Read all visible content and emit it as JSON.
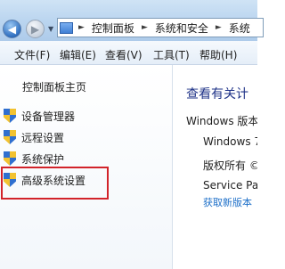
{
  "nav": {
    "back_glyph": "◀",
    "forward_glyph": "▶",
    "recent_glyph": "▼",
    "address": {
      "separator": "►",
      "crumbs": [
        "控制面板",
        "系统和安全",
        "系统"
      ]
    }
  },
  "menubar": {
    "items": [
      "文件(F)",
      "编辑(E)",
      "查看(V)",
      "工具(T)",
      "帮助(H)"
    ]
  },
  "sidebar": {
    "home": "控制面板主页",
    "items": [
      {
        "label": "设备管理器",
        "icon": "uac-shield-icon"
      },
      {
        "label": "远程设置",
        "icon": "uac-shield-icon"
      },
      {
        "label": "系统保护",
        "icon": "uac-shield-icon"
      },
      {
        "label": "高级系统设置",
        "icon": "uac-shield-icon"
      }
    ]
  },
  "content": {
    "heading": "查看有关计",
    "edition_label": "Windows 版本",
    "edition_name": "Windows 7",
    "copyright": "版权所有 ©",
    "service_pack": "Service Pac",
    "more_link": "获取新版本"
  },
  "colors": {
    "highlight": "#d2232a",
    "link": "#1d6fc8",
    "heading": "#1e3287"
  }
}
